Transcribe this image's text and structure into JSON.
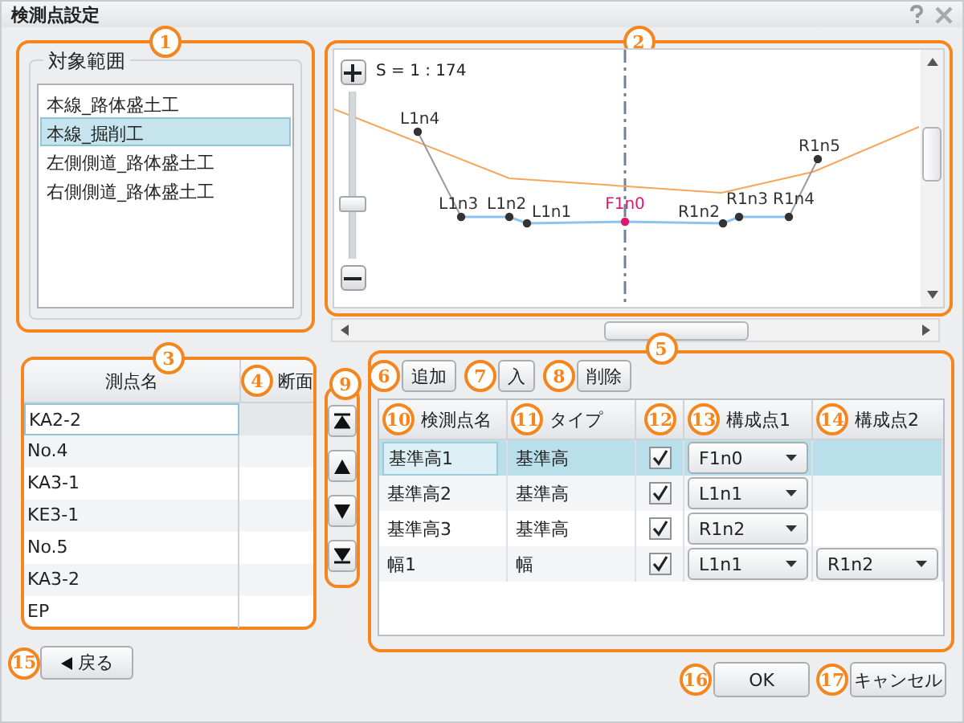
{
  "window": {
    "title": "検測点設定"
  },
  "target_range": {
    "callout": "1",
    "legend": "対象範囲",
    "items": [
      {
        "label": "本線_路体盛土工",
        "selected": false
      },
      {
        "label": "本線_掘削工",
        "selected": true
      },
      {
        "label": "左側側道_路体盛土工",
        "selected": false
      },
      {
        "label": "右側側道_路体盛土工",
        "selected": false
      }
    ]
  },
  "cross_section_view": {
    "callout": "2",
    "scale": "S = 1 : 174",
    "zoom": {
      "level": 0.33
    },
    "points": [
      {
        "label": "L1n4",
        "kind": "point"
      },
      {
        "label": "L1n3",
        "kind": "point"
      },
      {
        "label": "L1n2",
        "kind": "point"
      },
      {
        "label": "L1n1",
        "kind": "point"
      },
      {
        "label": "F1n0",
        "kind": "center"
      },
      {
        "label": "R1n2",
        "kind": "point"
      },
      {
        "label": "R1n3",
        "kind": "point"
      },
      {
        "label": "R1n4",
        "kind": "point"
      },
      {
        "label": "R1n5",
        "kind": "point"
      }
    ]
  },
  "stations": {
    "callout": "3",
    "columns": [
      {
        "label": "測点名"
      },
      {
        "label": "断面",
        "callout": "4"
      }
    ],
    "rows": [
      {
        "name": "KA2-2",
        "selected": true
      },
      {
        "name": "No.4",
        "selected": false
      },
      {
        "name": "KA3-1",
        "selected": false
      },
      {
        "name": "KE3-1",
        "selected": false
      },
      {
        "name": "No.5",
        "selected": false
      },
      {
        "name": "KA3-2",
        "selected": false
      },
      {
        "name": "EP",
        "selected": false
      }
    ]
  },
  "move_buttons": {
    "callout": "9"
  },
  "inspection_points": {
    "callout": "5",
    "buttons": [
      {
        "label": "追加",
        "callout": "6"
      },
      {
        "label": "入",
        "callout": "7"
      },
      {
        "label": "削除",
        "callout": "8"
      }
    ],
    "columns": [
      {
        "label": "検測点名",
        "callout": "10"
      },
      {
        "label": "タイプ",
        "callout": "11"
      },
      {
        "callout": "12"
      },
      {
        "label": "構成点1",
        "callout": "13"
      },
      {
        "label": "構成点2",
        "callout": "14"
      }
    ],
    "rows": [
      {
        "name": "基準高1",
        "type": "基準高",
        "checked": true,
        "point1": "F1n0",
        "selected": true
      },
      {
        "name": "基準高2",
        "type": "基準高",
        "checked": true,
        "point1": "L1n1",
        "selected": false
      },
      {
        "name": "基準高3",
        "type": "基準高",
        "checked": true,
        "point1": "R1n2",
        "selected": false
      },
      {
        "name": "幅1",
        "type": "幅",
        "checked": true,
        "point1": "L1n1",
        "point2": "R1n2",
        "selected": false
      }
    ]
  },
  "footer": {
    "back": {
      "label": "戻る",
      "callout": "15"
    },
    "ok": {
      "label": "OK",
      "callout": "16"
    },
    "cancel": {
      "label": "キャンセル",
      "callout": "17"
    }
  }
}
